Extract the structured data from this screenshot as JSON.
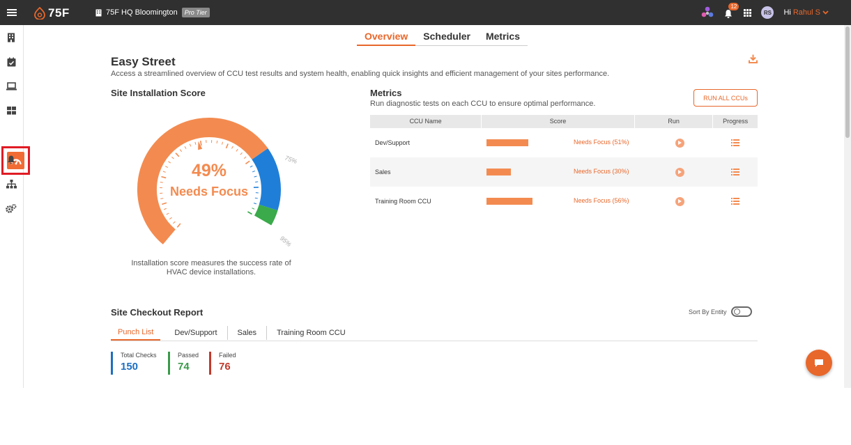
{
  "header": {
    "logo": "75F",
    "site_name": "75F HQ Bloomington",
    "tier": "Pro Tier",
    "notification_count": "12",
    "avatar_initials": "RS",
    "greeting": "Hi",
    "user_name": "Rahul S"
  },
  "tabs": [
    "Overview",
    "Scheduler",
    "Metrics"
  ],
  "page": {
    "title": "Easy Street",
    "subtitle": "Access a streamlined overview of CCU test results and system health, enabling quick insights and efficient management of your sites performance."
  },
  "installation": {
    "title": "Site Installation Score",
    "score_pct": 49,
    "score_label": "49%",
    "status": "Needs Focus",
    "mark_75": "75%",
    "mark_95": "95%",
    "caption": "Installation score measures the success rate of HVAC device installations."
  },
  "metrics": {
    "title": "Metrics",
    "subtitle": "Run diagnostic tests on each CCU to ensure optimal performance.",
    "run_all_label": "RUN ALL CCUs",
    "columns": [
      "CCU Name",
      "Score",
      "Run",
      "Progress"
    ],
    "rows": [
      {
        "name": "Dev/Support",
        "score_pct": 51,
        "score_text": "Needs Focus (51%)"
      },
      {
        "name": "Sales",
        "score_pct": 30,
        "score_text": "Needs Focus (30%)"
      },
      {
        "name": "Training Room CCU",
        "score_pct": 56,
        "score_text": "Needs Focus (56%)"
      }
    ]
  },
  "checkout": {
    "title": "Site Checkout Report",
    "sort_label": "Sort By Entity",
    "tabs": [
      "Punch List",
      "Dev/Support",
      "Sales",
      "Training Room CCU"
    ],
    "stats": [
      {
        "label": "Total Checks",
        "value": "150",
        "color": "#1e6fc0"
      },
      {
        "label": "Passed",
        "value": "74",
        "color": "#3a9a4a"
      },
      {
        "label": "Failed",
        "value": "76",
        "color": "#c0392b"
      }
    ]
  },
  "colors": {
    "accent": "#e8672b",
    "gauge_orange": "#f38b50",
    "gauge_blue": "#1f7fd8",
    "gauge_green": "#3aaa4a"
  },
  "sidebar": {
    "icons": [
      "building-icon",
      "calendar-check-icon",
      "laptop-icon",
      "dashboard-grid-icon",
      "speedometer-icon",
      "bell-icon",
      "org-chart-icon",
      "gears-icon"
    ],
    "active": "speedometer-icon"
  }
}
